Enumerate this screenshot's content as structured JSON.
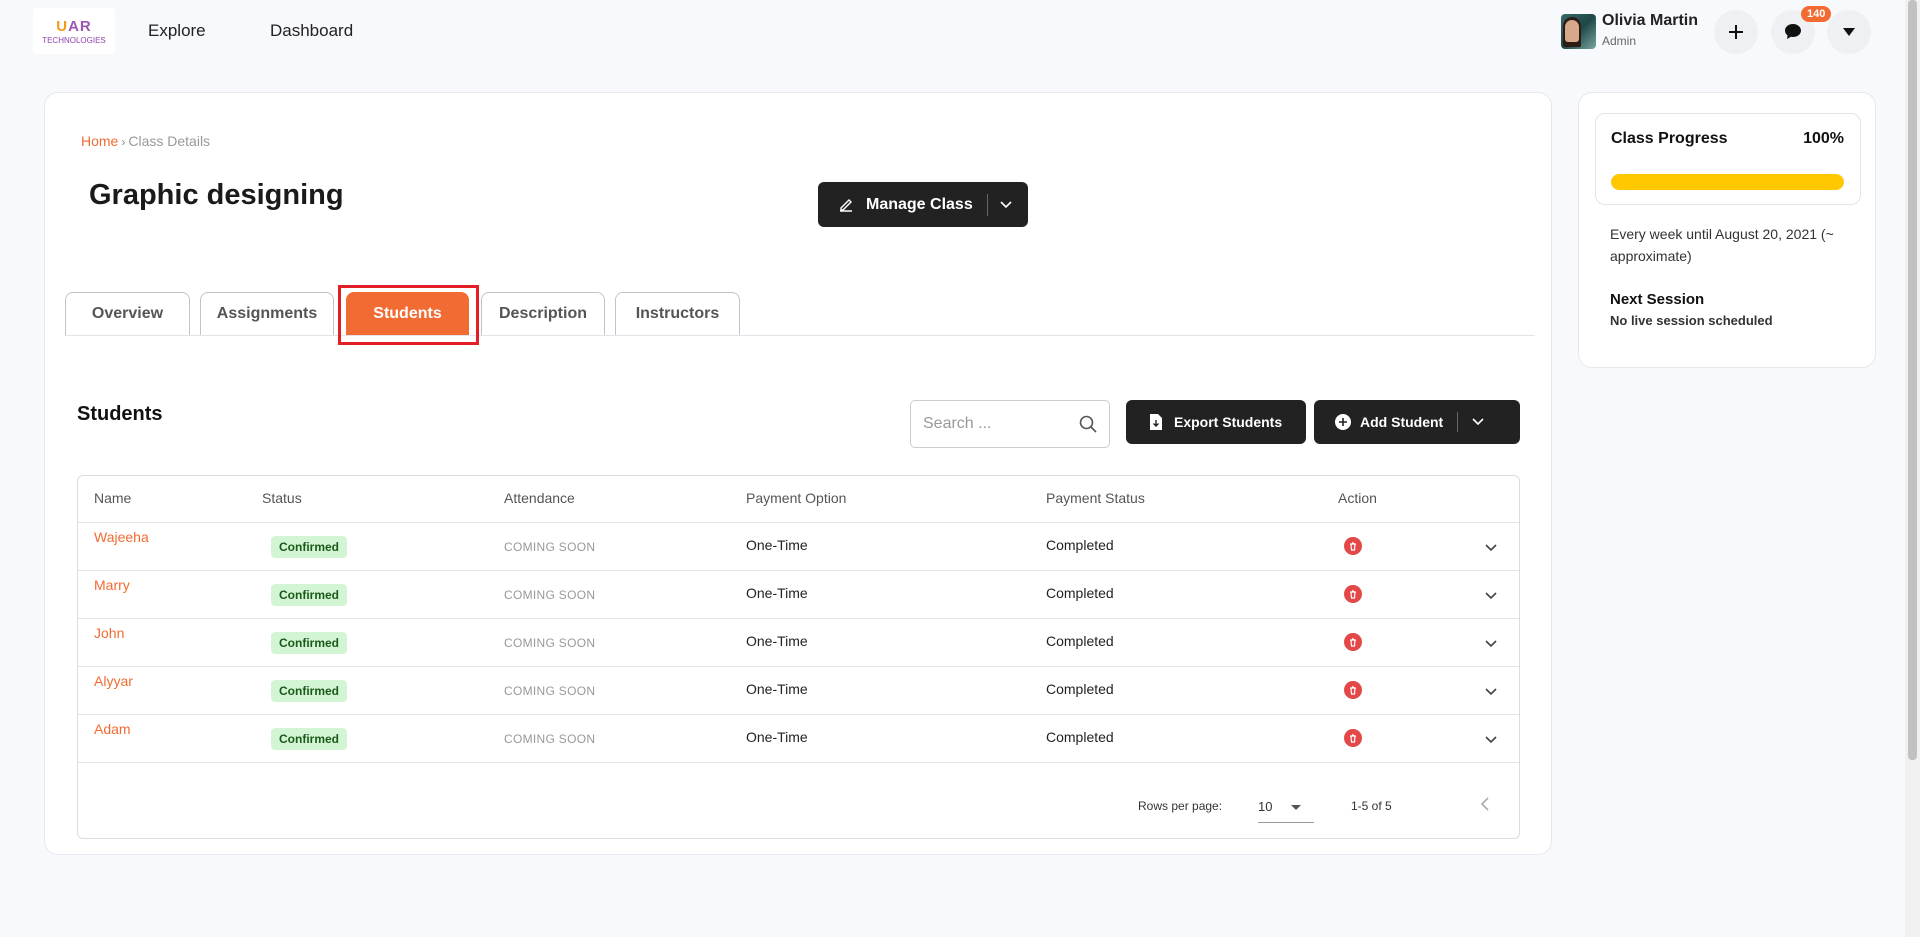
{
  "header": {
    "logo_line1_a": "U",
    "logo_line1_b": "A",
    "logo_line1_c": "R",
    "logo_line2": "TECHNOLOGIES",
    "nav": [
      "Explore",
      "Dashboard"
    ],
    "user": {
      "name": "Olivia Martin",
      "role": "Admin"
    },
    "messages_badge": "140"
  },
  "breadcrumb": {
    "home": "Home",
    "separator": "›",
    "current": "Class Details"
  },
  "page_title": "Graphic designing",
  "manage_button": {
    "label": "Manage Class"
  },
  "tabs": [
    {
      "label": "Overview",
      "active": false
    },
    {
      "label": "Assignments",
      "active": false
    },
    {
      "label": "Students",
      "active": true
    },
    {
      "label": "Description",
      "active": false
    },
    {
      "label": "Instructors",
      "active": false
    }
  ],
  "students": {
    "title": "Students",
    "search_placeholder": "Search ...",
    "export_label": "Export Students",
    "add_label": "Add Student",
    "columns": [
      "Name",
      "Status",
      "Attendance",
      "Payment Option",
      "Payment Status",
      "Action"
    ],
    "rows": [
      {
        "name": "Wajeeha",
        "status": "Confirmed",
        "attendance": "COMING SOON",
        "payment_option": "One-Time",
        "payment_status": "Completed"
      },
      {
        "name": "Marry",
        "status": "Confirmed",
        "attendance": "COMING SOON",
        "payment_option": "One-Time",
        "payment_status": "Completed"
      },
      {
        "name": "John",
        "status": "Confirmed",
        "attendance": "COMING SOON",
        "payment_option": "One-Time",
        "payment_status": "Completed"
      },
      {
        "name": "Alyyar",
        "status": "Confirmed",
        "attendance": "COMING SOON",
        "payment_option": "One-Time",
        "payment_status": "Completed"
      },
      {
        "name": "Adam",
        "status": "Confirmed",
        "attendance": "COMING SOON",
        "payment_option": "One-Time",
        "payment_status": "Completed"
      }
    ],
    "pagination": {
      "rows_per_page_label": "Rows per page:",
      "rows_per_page": "10",
      "range": "1-5 of 5"
    }
  },
  "side": {
    "progress_label": "Class Progress",
    "progress_value": "100%",
    "progress_fraction": 1.0,
    "schedule": "Every week until August 20, 2021 (~ approximate)",
    "next_session_title": "Next Session",
    "next_session_value": "No live session scheduled"
  },
  "colors": {
    "accent": "#f26b32",
    "dark_button": "#222222",
    "progress": "#ffc800",
    "confirmed_bg": "#d4f5d4",
    "delete": "#e34848",
    "highlight": "#e31e24"
  },
  "icons": [
    "plus-icon",
    "chat-icon",
    "caret-down-icon",
    "edit-icon",
    "chevron-down-icon",
    "search-icon",
    "file-export-icon",
    "plus-circle-icon",
    "trash-icon",
    "chevron-left-icon",
    "chevron-right-icon"
  ]
}
